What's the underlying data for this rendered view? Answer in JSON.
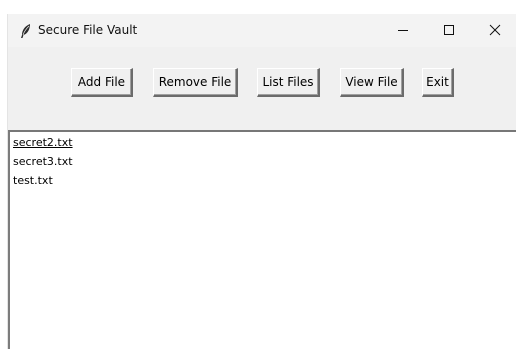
{
  "window": {
    "title": "Secure File Vault",
    "app_icon": "feather-icon",
    "controls": {
      "minimize_icon": "minimize-icon",
      "maximize_icon": "maximize-icon",
      "close_icon": "close-icon"
    }
  },
  "toolbar": {
    "buttons": [
      {
        "label": "Add File"
      },
      {
        "label": "Remove File"
      },
      {
        "label": "List Files"
      },
      {
        "label": "View File"
      },
      {
        "label": "Exit"
      }
    ]
  },
  "file_list": {
    "items": [
      {
        "name": "secret2.txt",
        "active": true
      },
      {
        "name": "secret3.txt",
        "active": false
      },
      {
        "name": "test.txt",
        "active": false
      }
    ]
  },
  "colors": {
    "window_bg": "#f0f0f0",
    "list_bg": "#ffffff",
    "text": "#000000"
  }
}
